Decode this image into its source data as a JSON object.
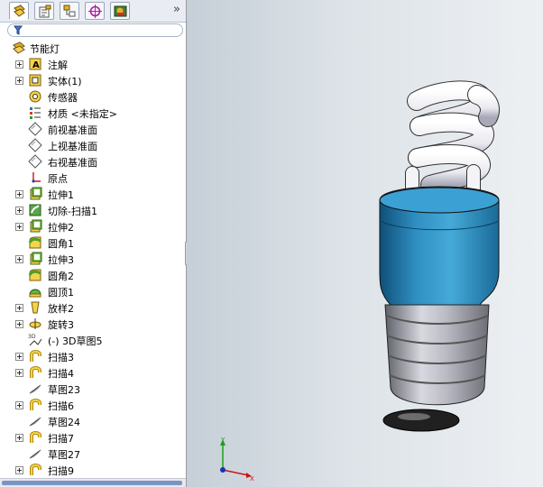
{
  "panel_tabs": [
    {
      "name": "featuremanager-tab",
      "icon": "featuremanager-icon"
    },
    {
      "name": "propertymanager-tab",
      "icon": "propertymanager-icon"
    },
    {
      "name": "configurationmanager-tab",
      "icon": "configurationmanager-icon"
    },
    {
      "name": "dimxpert-tab",
      "icon": "dimxpert-icon"
    },
    {
      "name": "display-manager-tab",
      "icon": "display-manager-icon"
    }
  ],
  "more_glyph": "»",
  "tree": {
    "root": "节能灯",
    "items": [
      {
        "label": "注解",
        "icon": "annotations-icon",
        "expandable": true
      },
      {
        "label": "实体(1)",
        "icon": "solid-bodies-icon",
        "expandable": true
      },
      {
        "label": "传感器",
        "icon": "sensors-icon",
        "expandable": false
      },
      {
        "label": "材质 <未指定>",
        "icon": "material-icon",
        "expandable": false
      },
      {
        "label": "前视基准面",
        "icon": "plane-icon",
        "expandable": false
      },
      {
        "label": "上视基准面",
        "icon": "plane-icon",
        "expandable": false
      },
      {
        "label": "右视基准面",
        "icon": "plane-icon",
        "expandable": false
      },
      {
        "label": "原点",
        "icon": "origin-icon",
        "expandable": false
      },
      {
        "label": "拉伸1",
        "icon": "extrude-icon",
        "expandable": true
      },
      {
        "label": "切除-扫描1",
        "icon": "cut-sweep-icon",
        "expandable": true
      },
      {
        "label": "拉伸2",
        "icon": "extrude-icon",
        "expandable": true
      },
      {
        "label": "圆角1",
        "icon": "fillet-icon",
        "expandable": false
      },
      {
        "label": "拉伸3",
        "icon": "extrude-icon",
        "expandable": true
      },
      {
        "label": "圆角2",
        "icon": "fillet-icon",
        "expandable": false
      },
      {
        "label": "圆顶1",
        "icon": "dome-icon",
        "expandable": false
      },
      {
        "label": "放样2",
        "icon": "loft-icon",
        "expandable": true
      },
      {
        "label": "旋转3",
        "icon": "revolve-icon",
        "expandable": true
      },
      {
        "label": "(-) 3D草图5",
        "icon": "sketch3d-icon",
        "expandable": false
      },
      {
        "label": "扫描3",
        "icon": "sweep-icon",
        "expandable": true
      },
      {
        "label": "扫描4",
        "icon": "sweep-icon",
        "expandable": true
      },
      {
        "label": "草图23",
        "icon": "sketch-icon",
        "expandable": false
      },
      {
        "label": "扫描6",
        "icon": "sweep-icon",
        "expandable": true
      },
      {
        "label": "草图24",
        "icon": "sketch-icon",
        "expandable": false
      },
      {
        "label": "扫描7",
        "icon": "sweep-icon",
        "expandable": true
      },
      {
        "label": "草图27",
        "icon": "sketch-icon",
        "expandable": false
      },
      {
        "label": "扫描9",
        "icon": "sweep-icon",
        "expandable": true
      }
    ]
  },
  "triad": {
    "y_label": "Y",
    "x_label": "X"
  }
}
